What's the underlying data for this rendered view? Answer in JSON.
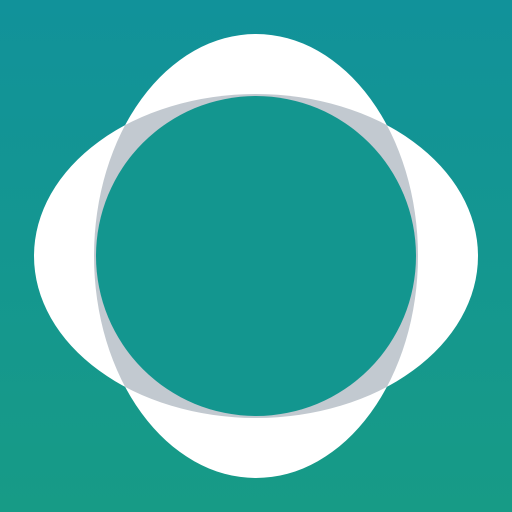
{
  "app": {
    "icon_name": "overlapping-circles-logo-icon"
  },
  "colors": {
    "background_top": "#11929a",
    "background_bottom": "#179b86",
    "outer_ring": "#ffffff",
    "overlap": "#c2c9d0",
    "center": "#13968f"
  }
}
